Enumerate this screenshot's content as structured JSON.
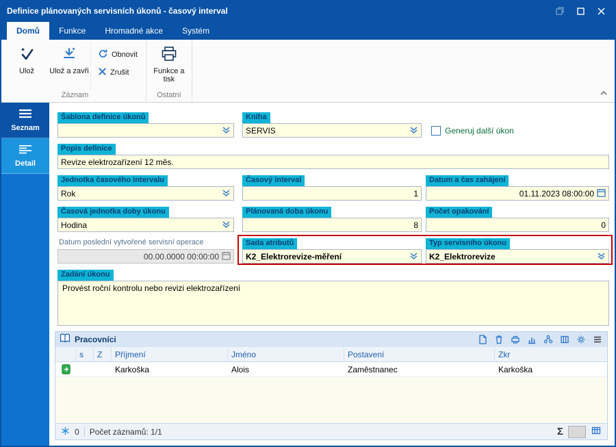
{
  "window": {
    "title": "Definice plánovaných servisních úkonů - časový interval"
  },
  "ribbon": {
    "tabs": [
      "Domů",
      "Funkce",
      "Hromadné akce",
      "Systém"
    ],
    "active_tab": "Domů",
    "save": "Ulož",
    "save_and_close": "Ulož a zavři",
    "refresh": "Obnovit",
    "cancel": "Zrušit",
    "functions_print": "Funkce a tisk",
    "group_record": "Záznam",
    "group_other": "Ostatní"
  },
  "sidebar": {
    "list": "Seznam",
    "detail": "Detail"
  },
  "form": {
    "template_label": "Šablona definice úkonů",
    "template_value": "",
    "book_label": "Kniha",
    "book_value": "SERVIS",
    "generate_next_label": "Generuj další úkon",
    "description_label": "Popis definice",
    "description_value": "Revize elektrozařízení 12 měs.",
    "interval_unit_label": "Jednotka časového intervalu",
    "interval_unit_value": "Rok",
    "interval_label": "Časový interval",
    "interval_value": "1",
    "start_label": "Datum a čas zahájení",
    "start_value": "01.11.2023 08:00:00",
    "duration_unit_label": "Časová jednotka doby úkonu",
    "duration_unit_value": "Hodina",
    "planned_duration_label": "Plánovaná doba úkonu",
    "planned_duration_value": "8",
    "repeat_label": "Počet opakování",
    "repeat_value": "0",
    "last_op_label": "Datum poslední vytvořené servisní operace",
    "last_op_value": "00.00.0000 00:00:00",
    "attr_set_label": "Sada atributů",
    "attr_set_value": "K2_Elektrorevize-měření",
    "task_type_label": "Typ servisního úkonu",
    "task_type_value": "K2_Elektrorevize",
    "task_label": "Zadání úkonu",
    "task_value": "Provést roční kontrolu nebo revizi elektrozařízení"
  },
  "grid": {
    "title": "Pracovníci",
    "columns": [
      "",
      "s",
      "Z",
      "Příjmení",
      "Jméno",
      "Postavení",
      "Zkr"
    ],
    "row": {
      "prijmeni": "Karkoška",
      "jmeno": "Alois",
      "postaveni": "Zaměstnanec",
      "zkr": "Karkoška"
    },
    "footer": {
      "badge": "0",
      "count": "Počet záznamů: 1/1",
      "sum": "Σ"
    }
  },
  "icons": {
    "save-icon": "checkmark with star",
    "save-close-icon": "down arrow with star",
    "refresh-icon": "circular arrows",
    "cancel-icon": "x cross",
    "print-icon": "printer",
    "dropdown-icon": "double chevron down",
    "calendar-icon": "calendar grid",
    "book-icon": "open book",
    "menu-icon": "hamburger lines",
    "record-status-icon": "green document"
  },
  "colors": {
    "titlebar": "#0a53a6",
    "sidebar": "#0f72ce",
    "chip": "#10b4d6",
    "field_bg": "#ffffe2",
    "highlight": "#c40000"
  }
}
